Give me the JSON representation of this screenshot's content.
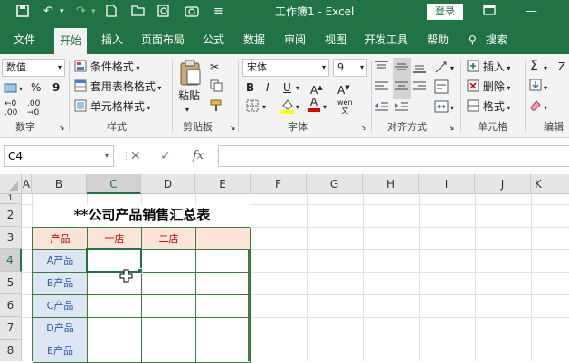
{
  "titlebar": {
    "title": "工作簿1 - Excel",
    "login_label": "登录"
  },
  "menu": [
    "文件",
    "开始",
    "插入",
    "页面布局",
    "公式",
    "数据",
    "审阅",
    "视图",
    "开发工具",
    "帮助",
    "搜索"
  ],
  "ribbon": {
    "number_format": "数值",
    "percent_symbol": "%",
    "comma_symbol": "9",
    "conditional_format": "条件格式",
    "table_format": "套用表格格式",
    "cell_style": "单元格样式",
    "paste_label": "粘贴",
    "font_name": "宋体",
    "font_size": "9",
    "insert_label": "插入",
    "delete_label": "删除",
    "format_label": "格式",
    "bold": "B",
    "italic": "I",
    "underline": "U",
    "font_color_glyph": "A",
    "wen_glyph": "wén",
    "sort_glyph": "Z",
    "groups": [
      "数字",
      "样式",
      "剪贴板",
      "字体",
      "对齐方式",
      "单元格",
      "编辑"
    ]
  },
  "formula_bar": {
    "name_box": "C4",
    "fx": "fx",
    "content": ""
  },
  "columns": [
    "A",
    "B",
    "C",
    "D",
    "E",
    "F",
    "G",
    "H",
    "I",
    "J",
    "K"
  ],
  "rows": [
    "1",
    "2",
    "3",
    "4",
    "5",
    "6",
    "7",
    "8"
  ],
  "sheet": {
    "title": "**公司产品销售汇总表",
    "header": [
      "产品",
      "一店",
      "二店",
      ""
    ],
    "products": [
      "A产品",
      "B产品",
      "C产品",
      "D产品",
      "E产品"
    ]
  },
  "colors": {
    "accent": "#217346",
    "header_fill": "#fce4d6",
    "product_fill": "#dde6f4",
    "header_text": "#c00000",
    "product_text": "#2e5aa8"
  }
}
